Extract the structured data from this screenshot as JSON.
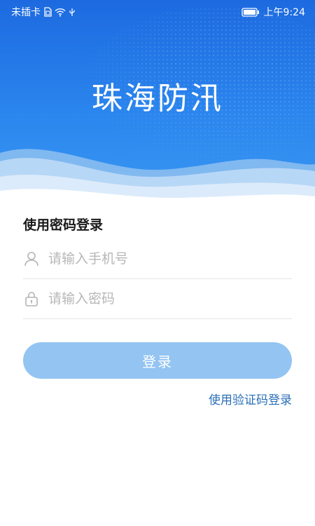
{
  "status_bar": {
    "carrier": "未插卡",
    "time": "上午9:24",
    "icons": [
      "sim-icon",
      "wifi-icon",
      "usb-icon",
      "battery-icon"
    ]
  },
  "header": {
    "title": "珠海防汛",
    "gradient_top": "#1d6ae0",
    "gradient_bottom": "#3b99f2"
  },
  "form": {
    "title": "使用密码登录",
    "phone_placeholder": "请输入手机号",
    "password_placeholder": "请输入密码"
  },
  "actions": {
    "login_label": "登录",
    "login_color": "#93c4f2",
    "alt_login_label": "使用验证码登录",
    "alt_login_color": "#2a6fb6"
  }
}
